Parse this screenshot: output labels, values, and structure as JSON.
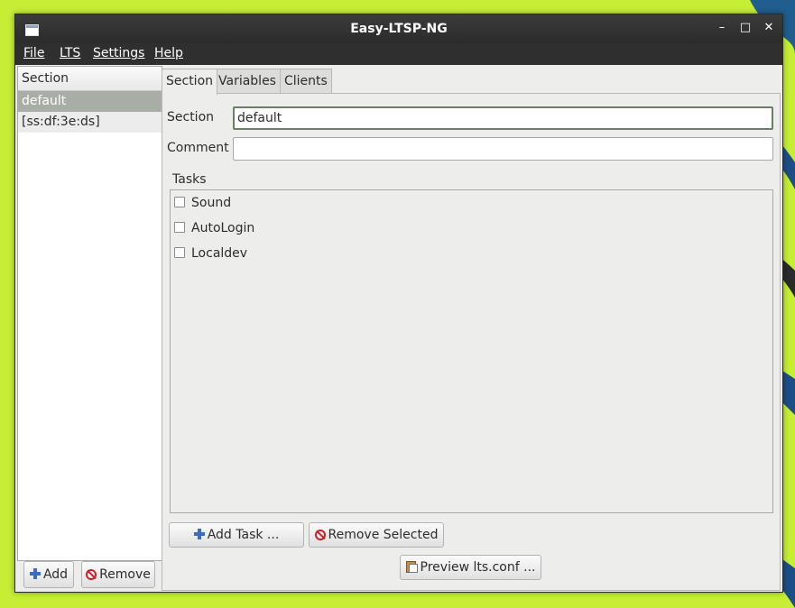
{
  "window": {
    "title": "Easy-LTSP-NG",
    "controls": {
      "minimize": "–",
      "maximize": "□",
      "close": "✕"
    }
  },
  "menu": {
    "file": "File",
    "lts": "LTS",
    "settings": "Settings",
    "help": "Help"
  },
  "sidebar": {
    "header": "Section",
    "items": [
      {
        "label": "default",
        "selected": true
      },
      {
        "label": "[ss:df:3e:ds]",
        "selected": false
      }
    ],
    "add_label": "Add",
    "remove_label": "Remove"
  },
  "tabs": [
    {
      "label": "Section",
      "active": true
    },
    {
      "label": "Variables",
      "active": false
    },
    {
      "label": "Clients",
      "active": false
    }
  ],
  "form": {
    "section_label": "Section",
    "section_value": "default",
    "comment_label": "Comment",
    "comment_value": "",
    "tasks_label": "Tasks",
    "tasks": [
      {
        "label": "Sound",
        "checked": false
      },
      {
        "label": "AutoLogin",
        "checked": false
      },
      {
        "label": "Localdev",
        "checked": false
      }
    ]
  },
  "buttons": {
    "add_task": "Add Task ...",
    "remove_selected": "Remove Selected",
    "preview": "Preview lts.conf ..."
  },
  "icons": {
    "add": "plus-icon",
    "remove": "stop-icon",
    "preview": "clipboard-icon",
    "app": "window-icon"
  },
  "colors": {
    "desktop": "#c6ee34",
    "titlebar": "#2b2b2b",
    "selection": "#a8aea6",
    "accent_blue": "#3a6cc4",
    "stop_red": "#c9202a"
  }
}
